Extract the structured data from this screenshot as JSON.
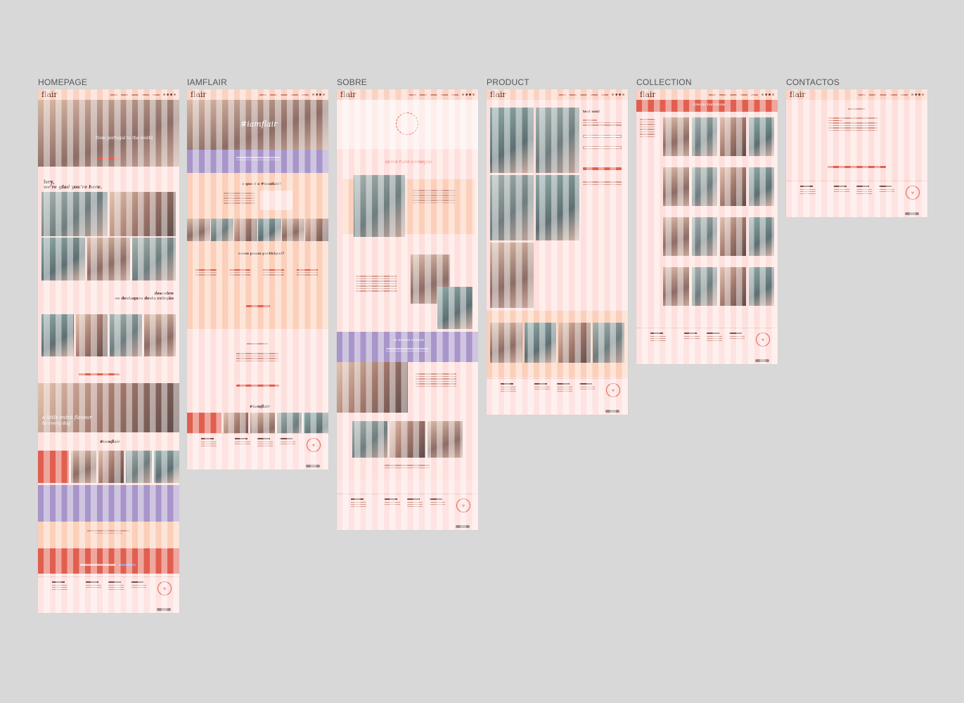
{
  "boards": {
    "homepage": "HOMEPAGE",
    "iamflair": "IAMFLAIR",
    "sobre": "SOBRE",
    "product": "PRODUCT",
    "collection": "COLLECTION",
    "contactos": "CONTACTOS"
  },
  "brand": {
    "logo": "flair"
  },
  "homepage": {
    "hero": "from portugal to the world",
    "greeting_1": "hey,",
    "greeting_2": "we're glad you're here.",
    "highlights_1": "descobre",
    "highlights_2": "os destaques desta coleção",
    "banner_1": "a little extra flavour",
    "banner_2": "to every day",
    "hashtag": "#iamflair"
  },
  "iamflair": {
    "hero": "#iamflair",
    "question": "o que é o #iamflair?",
    "participate": "como posso participar?",
    "hashtag": "#iamflair"
  },
  "sobre": {
    "title": "como tudo começou",
    "values": "os nossos valores"
  },
  "product": {
    "name": "teal soul"
  },
  "collection": {
    "title": "coleção barcelona"
  },
  "colors": {
    "peach": "#fbcfb9",
    "pink": "#fde0dd",
    "lavender": "#a895c9",
    "coral": "#e15f4f"
  }
}
